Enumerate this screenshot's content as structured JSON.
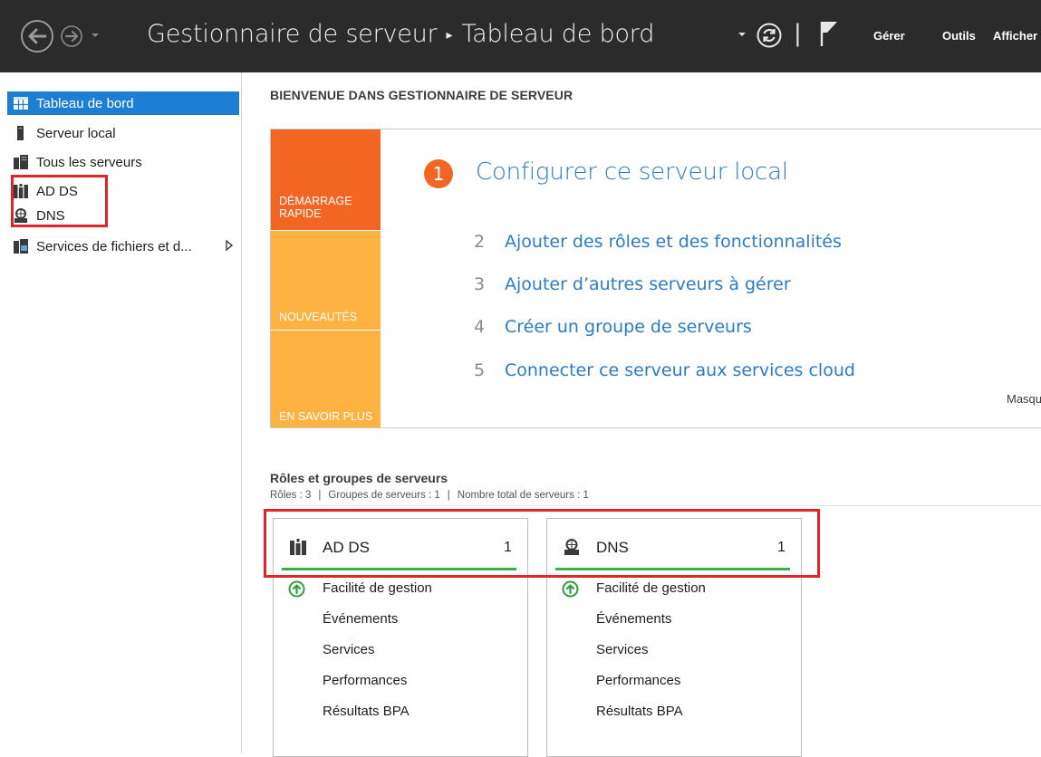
{
  "titlebar": {
    "app_title": "Gestionnaire de serveur",
    "separator": "▸",
    "page_title": "Tableau de bord",
    "pipe": "|",
    "menus": [
      "Gérer",
      "Outils",
      "Afficher"
    ]
  },
  "sidebar": {
    "items": [
      {
        "label": "Tableau de bord",
        "icon": "dashboard-icon",
        "active": true
      },
      {
        "label": "Serveur local",
        "icon": "server-icon"
      },
      {
        "label": "Tous les serveurs",
        "icon": "servers-icon"
      },
      {
        "label": "AD DS",
        "icon": "ad-ds-icon"
      },
      {
        "label": "DNS",
        "icon": "dns-icon"
      },
      {
        "label": "Services de fichiers et d...",
        "icon": "file-services-icon",
        "has_submenu": true
      }
    ]
  },
  "welcome": {
    "title": "BIENVENUE DANS GESTIONNAIRE DE SERVEUR",
    "tabs": [
      {
        "line1": "DÉMARRAGE",
        "line2": "RAPIDE"
      },
      {
        "line1": "NOUVEAUTÉS"
      },
      {
        "line1": "EN SAVOIR PLUS"
      }
    ],
    "steps": [
      {
        "num": "1",
        "label": "Configurer ce serveur local"
      },
      {
        "num": "2",
        "label": "Ajouter des rôles et des fonctionnalités"
      },
      {
        "num": "3",
        "label": "Ajouter d’autres serveurs à gérer"
      },
      {
        "num": "4",
        "label": "Créer un groupe de serveurs"
      },
      {
        "num": "5",
        "label": "Connecter ce serveur aux services cloud"
      }
    ],
    "hide_label": "Masqu"
  },
  "roles": {
    "title": "Rôles et groupes de serveurs",
    "summary": {
      "roles": "Rôles : 3",
      "groups": "Groupes de serveurs : 1",
      "total": "Nombre total de serveurs : 1",
      "bar": "|"
    },
    "tiles": [
      {
        "name": "AD DS",
        "count": "1",
        "rows": [
          "Facilité de gestion",
          "Événements",
          "Services",
          "Performances",
          "Résultats BPA"
        ]
      },
      {
        "name": "DNS",
        "count": "1",
        "rows": [
          "Facilité de gestion",
          "Événements",
          "Services",
          "Performances",
          "Résultats BPA"
        ]
      }
    ]
  },
  "colors": {
    "titlebar_bg": "#2b2b2b",
    "selected": "#1e7ed4",
    "quickstart_orange": "#f26522",
    "tab_yellow": "#fdb242",
    "link_blue": "#2b7cc4",
    "status_green": "#3cb34a",
    "highlight_red": "#e0242a"
  }
}
